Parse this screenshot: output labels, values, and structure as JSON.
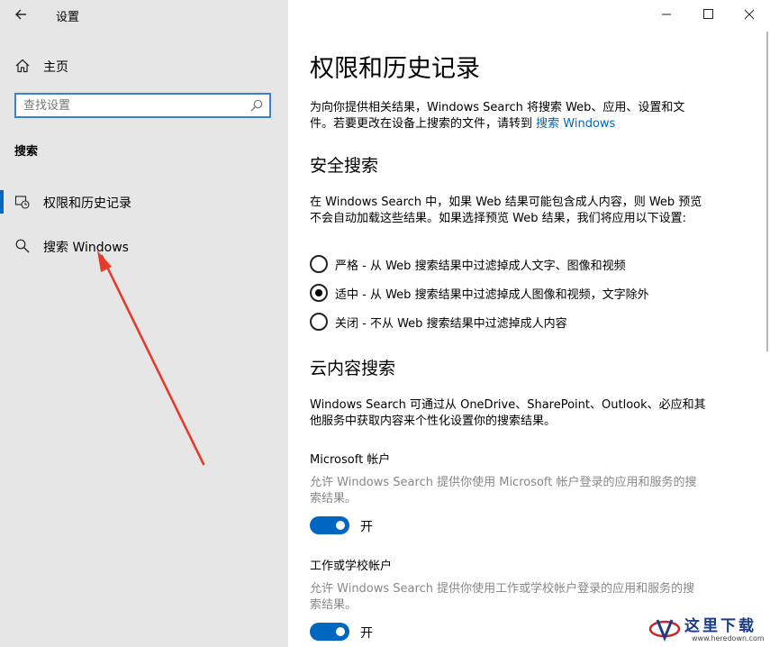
{
  "app": {
    "title": "设置"
  },
  "sidebar": {
    "home_label": "主页",
    "search_placeholder": "查找设置",
    "section_label": "搜索",
    "items": [
      {
        "label": "权限和历史记录",
        "icon": "permission-history-icon",
        "selected": true
      },
      {
        "label": "搜索 Windows",
        "icon": "search-icon",
        "selected": false
      }
    ]
  },
  "annotation": {
    "arrow_color": "#e53b2c"
  },
  "main": {
    "title": "权限和历史记录",
    "intro": {
      "text_line1": "为向你提供相关结果，Windows Search 将搜索 Web、应用、设置和文",
      "text_line2": "件。若要更改在设备上搜索的文件，请转到 ",
      "link": "搜索 Windows"
    },
    "safe_search": {
      "heading": "安全搜索",
      "description_line1": "在 Windows Search 中，如果 Web 结果可能包含成人内容，则 Web 预览",
      "description_line2": "不会自动加载这些结果。如果选择预览 Web 结果，我们将应用以下设置:",
      "options": [
        {
          "label": "严格 - 从 Web 搜索结果中过滤掉成人文字、图像和视频",
          "selected": false
        },
        {
          "label": "适中 - 从 Web 搜索结果中过滤掉成人图像和视频，文字除外",
          "selected": true
        },
        {
          "label": "关闭 - 不从 Web 搜索结果中过滤掉成人内容",
          "selected": false
        }
      ]
    },
    "cloud_search": {
      "heading": "云内容搜索",
      "description_line1": "Windows Search 可通过从 OneDrive、SharePoint、Outlook、必应和其",
      "description_line2": "他服务中获取内容来个性化设置你的搜索结果。",
      "microsoft_account": {
        "title": "Microsoft 帐户",
        "description_line1": "允许 Windows Search 提供你使用 Microsoft 帐户登录的应用和服务的搜",
        "description_line2": "索结果。",
        "toggle_label": "开",
        "on": true
      },
      "work_account": {
        "title": "工作或学校帐户",
        "description_line1": "允许 Windows Search 提供你使用工作或学校帐户登录的应用和服务的搜",
        "description_line2": "索结果。",
        "toggle_label": "开",
        "on": true
      }
    }
  },
  "accent_color": "#0067c0",
  "watermark": {
    "text": "这里下载",
    "url": "www.heredown.com"
  }
}
